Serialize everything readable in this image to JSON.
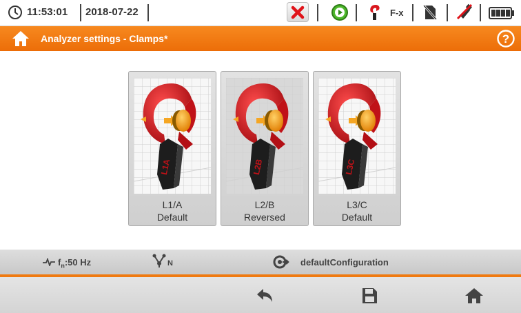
{
  "status": {
    "time": "11:53:01",
    "date": "2018-07-22",
    "fx_label": "F-x"
  },
  "title": {
    "text": "Analyzer settings - Clamps*"
  },
  "clamps": [
    {
      "phase": "L1/A",
      "mode": "Default",
      "marking": "L1A"
    },
    {
      "phase": "L2/B",
      "mode": "Reversed",
      "marking": "L2B"
    },
    {
      "phase": "L3/C",
      "mode": "Default",
      "marking": "L3C"
    }
  ],
  "info": {
    "frequency_main": "f",
    "frequency_sub": "n",
    "frequency_value": ":50 Hz",
    "network_sub": "N",
    "configuration": "defaultConfiguration"
  },
  "colors": {
    "accent": "#f07a10",
    "clamp_red": "#d9181e",
    "clamp_orange": "#f39c12"
  }
}
